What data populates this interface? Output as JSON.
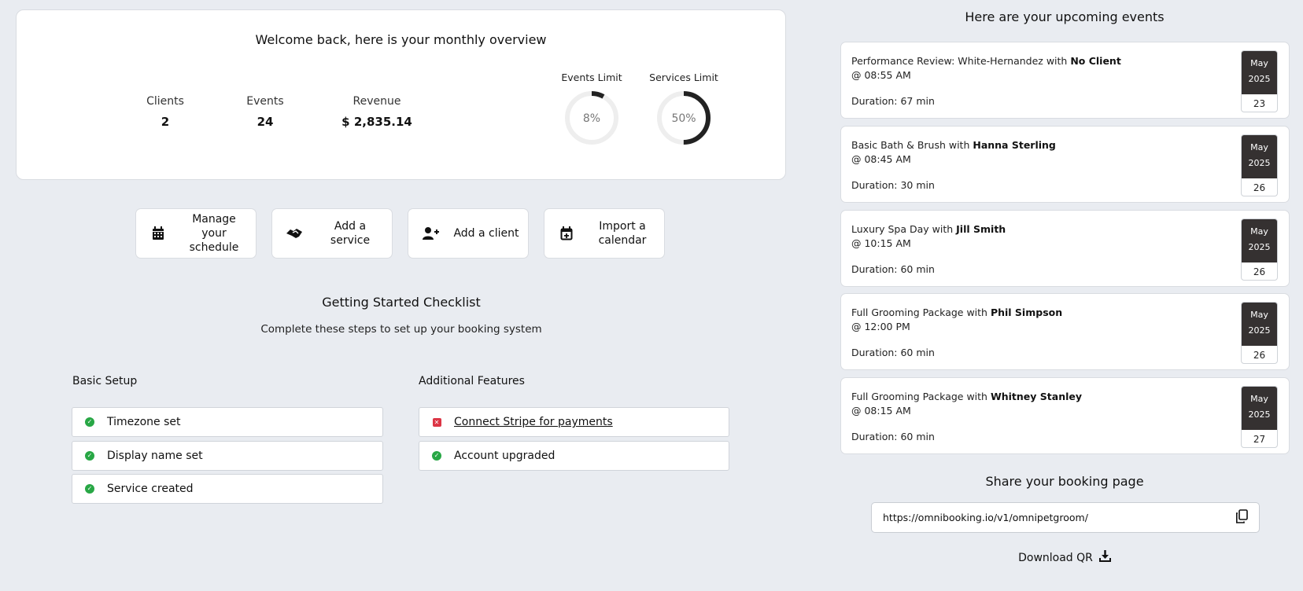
{
  "overview": {
    "title": "Welcome back, here is your monthly overview",
    "stats": [
      {
        "label": "Clients",
        "value": "2"
      },
      {
        "label": "Events",
        "value": "24"
      },
      {
        "label": "Revenue",
        "value": "$ 2,835.14"
      }
    ],
    "gauges": [
      {
        "label": "Events Limit",
        "value_text": "8%",
        "fraction": 0.08
      },
      {
        "label": "Services Limit",
        "value_text": "50%",
        "fraction": 0.5
      }
    ]
  },
  "actions": [
    {
      "label": "Manage your schedule",
      "icon": "calendar-grid-icon"
    },
    {
      "label": "Add a service",
      "icon": "handshake-icon"
    },
    {
      "label": "Add a client",
      "icon": "user-plus-icon"
    },
    {
      "label": "Import a calendar",
      "icon": "calendar-plus-icon"
    }
  ],
  "checklist": {
    "title": "Getting Started Checklist",
    "subtitle": "Complete these steps to set up your booking system",
    "basic": {
      "heading": "Basic Setup",
      "items": [
        {
          "label": "Timezone set",
          "status": "done"
        },
        {
          "label": "Display name set",
          "status": "done"
        },
        {
          "label": "Service created",
          "status": "done"
        }
      ]
    },
    "additional": {
      "heading": "Additional Features",
      "items": [
        {
          "label": "Connect Stripe for payments",
          "status": "todo"
        },
        {
          "label": "Account upgraded",
          "status": "done"
        }
      ]
    }
  },
  "events": {
    "title": "Here are your upcoming events",
    "items": [
      {
        "service": "Performance Review: White-Hernandez with ",
        "client": "No Client",
        "time": "@ 08:55 AM",
        "duration": "Duration: 67 min",
        "month": "May",
        "year": "2025",
        "day": "23"
      },
      {
        "service": "Basic Bath & Brush with ",
        "client": "Hanna Sterling",
        "time": "@ 08:45 AM",
        "duration": "Duration: 30 min",
        "month": "May",
        "year": "2025",
        "day": "26"
      },
      {
        "service": "Luxury Spa Day with ",
        "client": "Jill Smith",
        "time": "@ 10:15 AM",
        "duration": "Duration: 60 min",
        "month": "May",
        "year": "2025",
        "day": "26"
      },
      {
        "service": "Full Grooming Package with ",
        "client": "Phil Simpson",
        "time": "@ 12:00 PM",
        "duration": "Duration: 60 min",
        "month": "May",
        "year": "2025",
        "day": "26"
      },
      {
        "service": "Full Grooming Package with ",
        "client": "Whitney Stanley",
        "time": "@ 08:15 AM",
        "duration": "Duration: 60 min",
        "month": "May",
        "year": "2025",
        "day": "27"
      }
    ]
  },
  "share": {
    "title": "Share your booking page",
    "url": "https://omnibooking.io/v1/omnipetgroom/",
    "download_label": "Download QR"
  },
  "colors": {
    "background": "#e9ecf1",
    "date_header": "#353131",
    "success": "#28a745",
    "danger": "#dc3545",
    "gauge_track": "#eeeeee",
    "gauge_fill": "#222222"
  }
}
